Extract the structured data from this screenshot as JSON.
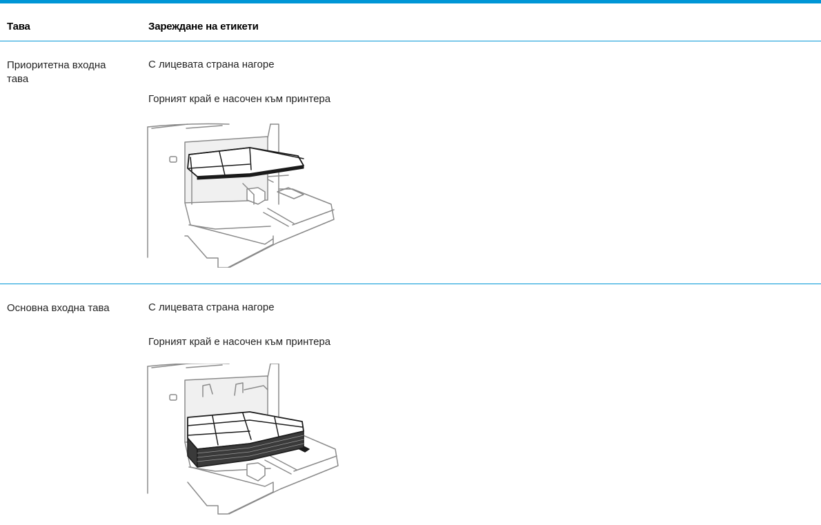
{
  "table": {
    "headers": {
      "tray": "Тава",
      "loading": "Зареждане на етикети"
    },
    "rows": [
      {
        "tray": "Приоритетна входна тава",
        "orientation": "С лицевата страна нагоре",
        "edge": "Горният край е насочен към принтера",
        "illustration": "printer-priority-tray-labels"
      },
      {
        "tray": "Основна входна тава",
        "orientation": "С лицевата страна нагоре",
        "edge": "Горният край е насочен към принтера",
        "illustration": "printer-main-tray-labels"
      }
    ]
  },
  "colors": {
    "accent": "#0096d6",
    "text": "#222222"
  }
}
